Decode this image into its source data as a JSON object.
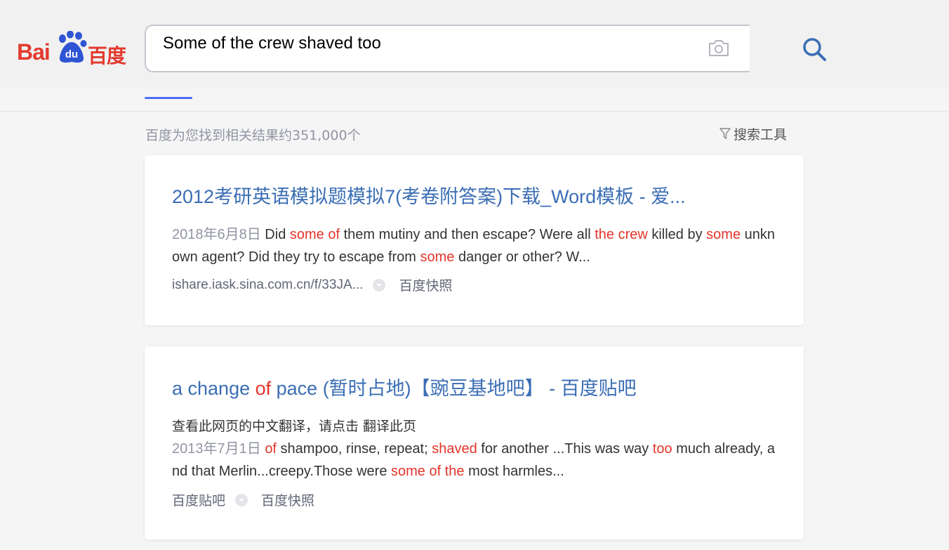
{
  "header": {
    "logo": {
      "bai": "Bai",
      "du": "du",
      "cn": "百度"
    },
    "search": {
      "value": "Some of the crew shaved too"
    }
  },
  "results_info": {
    "count_text": "百度为您找到相关结果约351,000个",
    "tools_label": "搜索工具"
  },
  "results": [
    {
      "title": "2012考研英语模拟题模拟7(考卷附答案)下载_Word模板 - 爱...",
      "date": "2018年6月8日",
      "snippet": [
        {
          "t": " Did ",
          "hl": false
        },
        {
          "t": "some of",
          "hl": true
        },
        {
          "t": " them mutiny and then escape? Were all ",
          "hl": false
        },
        {
          "t": "the crew",
          "hl": true
        },
        {
          "t": " killed by ",
          "hl": false
        },
        {
          "t": "some",
          "hl": true
        },
        {
          "t": " unkn own agent? Did they try to escape from ",
          "hl": false
        },
        {
          "t": "some",
          "hl": true
        },
        {
          "t": " danger or other? W...",
          "hl": false
        }
      ],
      "source": "ishare.iask.sina.com.cn/f/33JA...",
      "snapshot": "百度快照"
    },
    {
      "title_parts": [
        {
          "t": "a change ",
          "hl": false
        },
        {
          "t": "of",
          "hl": true
        },
        {
          "t": " pace (暂时占地)【豌豆基地吧】 - 百度贴吧",
          "hl": false
        }
      ],
      "translate_note": "查看此网页的中文翻译，请点击 翻译此页",
      "date": "2013年7月1日",
      "snippet": [
        {
          "t": " ",
          "hl": false
        },
        {
          "t": "of",
          "hl": true
        },
        {
          "t": " shampoo, rinse, repeat; ",
          "hl": false
        },
        {
          "t": "shaved",
          "hl": true
        },
        {
          "t": " for another ...This was way ",
          "hl": false
        },
        {
          "t": "too",
          "hl": true
        },
        {
          "t": " much already, a nd that Merlin...creepy.Those were ",
          "hl": false
        },
        {
          "t": "some of the",
          "hl": true
        },
        {
          "t": " most harmles...",
          "hl": false
        }
      ],
      "source": "百度贴吧",
      "snapshot": "百度快照"
    }
  ],
  "colors": {
    "brand_red": "#e33b30",
    "brand_blue": "#2f55d4",
    "link_blue": "#3b6eb4",
    "highlight_red": "#e3352a",
    "tab_indicator": "#4e6ef2"
  },
  "icons": {
    "camera": "camera-icon",
    "search": "search-icon",
    "filter": "filter-icon",
    "dropdown": "chevron-down-circle-icon"
  }
}
